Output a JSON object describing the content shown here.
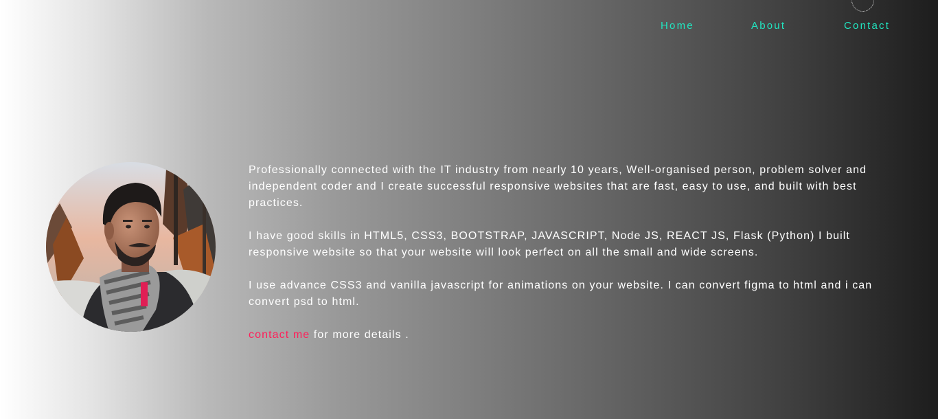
{
  "nav": {
    "items": [
      {
        "label": "Home"
      },
      {
        "label": "About"
      },
      {
        "label": "Contact"
      }
    ]
  },
  "profile": {
    "photo_alt": "Profile photo"
  },
  "about": {
    "paragraphs": [
      "Professionally connected with the IT industry from nearly 10 years, Well-organised person, problem solver and independent coder and I create successful responsive websites that are fast, easy to use, and built with best practices.",
      "I have good skills in HTML5, CSS3, BOOTSTRAP, JAVASCRIPT, Node JS, REACT JS, Flask (Python) I built responsive website so that your website will look perfect on all the small and wide screens.",
      "I use advance CSS3 and vanilla javascript for animations on your website. I can convert figma to html and i can convert psd to html."
    ],
    "contact_link": "contact me",
    "contact_suffix": " for more details ."
  },
  "colors": {
    "nav_accent": "#21e6c1",
    "link_accent": "#ff1f5a",
    "text": "#ffffff"
  }
}
